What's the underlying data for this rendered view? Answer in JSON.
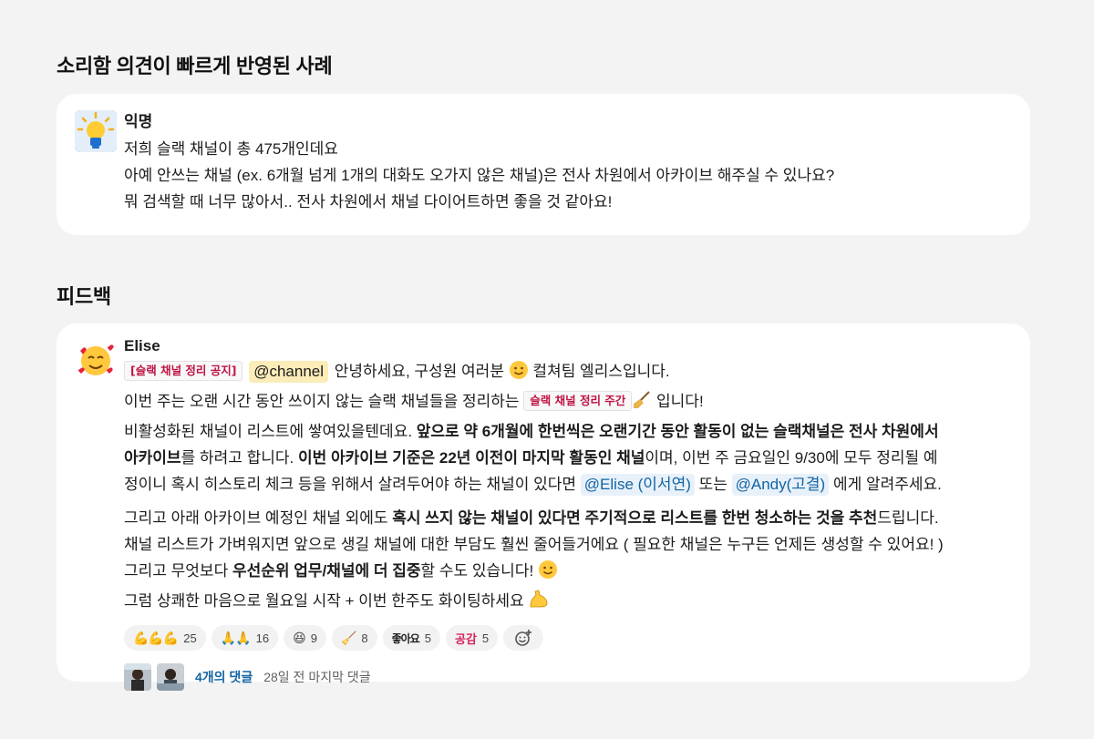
{
  "section1": {
    "title": "소리함 의견이 빠르게 반영된 사례"
  },
  "post1": {
    "author": "익명",
    "avatar_icon": "lightbulb-icon",
    "lines": [
      "저희 슬랙 채널이 총 475개인데요",
      "아예 안쓰는 채널 (ex. 6개월 넘게 1개의 대화도 오가지 않은 채널)은 전사 차원에서 아카이브 해주실 수 있나요?",
      "뭐 검색할 때 너무 많아서.. 전사 차원에서 채널 다이어트하면 좋을 것 같아요!"
    ]
  },
  "section2": {
    "title": "피드백"
  },
  "post2": {
    "author": "Elise",
    "avatar_icon": "smiling-face-with-hearts-icon",
    "tag_notice": "[슬랙 채널 정리 공지]",
    "channel_mention": "@channel",
    "greeting": " 안녕하세요, 구성원 여러분 ",
    "greeting2": " 컬쳐팀 엘리스입니다.",
    "l2_a": "이번 주는 오랜 시간 동안 쓰이지 않는 슬랙 채널들을 정리하는 ",
    "l2_tag": "슬랙 채널 정리 주간",
    "l2_b": " 입니다!",
    "l3_a": "비활성화된 채널이 리스트에 쌓여있을텐데요. ",
    "l3_b": "앞으로 약 6개월에 한번씩은 오랜기간 동안 활동이 없는 슬랙채널은 전사 차원에서",
    "l4_a": "아카이브",
    "l4_b": "를 하려고 합니다. ",
    "l4_c": "이번 아카이브 기준은 22년 이전이 마지막 활동인 채널",
    "l4_d": "이며, 이번 주 금요일인 9/30에 모두 정리될 예",
    "l5_a": "정이니 혹시 히스토리 체크 등을 위해서 살려두어야 하는 채널이 있다면 ",
    "mention_elise": "@Elise (이서연)",
    "l5_b": " 또는 ",
    "mention_andy": "@Andy(고결)",
    "l5_c": " 에게 알려주세요.",
    "l6_a": "그리고 아래 아카이브 예정인 채널 외에도 ",
    "l6_b": "혹시 쓰지 않는 채널이 있다면 주기적으로 리스트를 한번 청소하는 것을 추천",
    "l6_c": "드립니다.",
    "l7": "채널 리스트가 가벼워지면 앞으로 생길 채널에 대한 부담도 훨씬 줄어들거에요 (  필요한 채널은 누구든 언제든 생성할 수 있어요! )",
    "l8_a": "그리고 무엇보다 ",
    "l8_b": "우선순위 업무/채널에 더 집중",
    "l8_c": "할 수도 있습니다! ",
    "l9": "그럼 상쾌한 마음으로 월요일 시작 + 이번 한주도 화이팅하세요 "
  },
  "reactions": [
    {
      "icon": "flexed-biceps-icon",
      "glyphs": "💪💪💪",
      "count": "25"
    },
    {
      "icon": "folded-hands-icon",
      "glyphs": "🙏🙏",
      "count": "16"
    },
    {
      "icon": "grinning-squinting-face-icon",
      "glyphs": "😆",
      "count": "9"
    },
    {
      "icon": "broom-icon",
      "glyphs": "🧹",
      "count": "8"
    },
    {
      "icon": "like-text-icon",
      "glyphs": "좋아요",
      "count": "5"
    },
    {
      "icon": "empathy-text-icon",
      "glyphs": "공감",
      "count": "5"
    }
  ],
  "thread": {
    "replies": "4개의 댓글",
    "last_reply": "28일 전 마지막 댓글"
  }
}
